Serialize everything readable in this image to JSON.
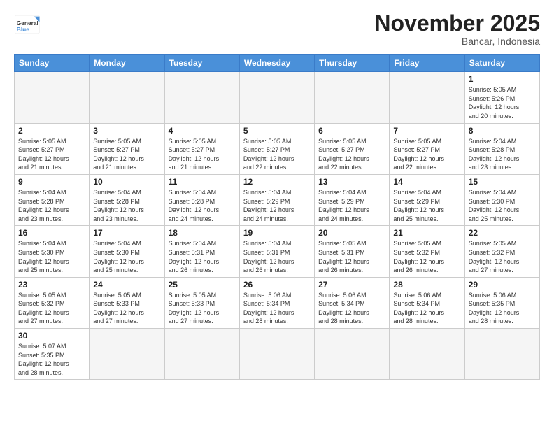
{
  "header": {
    "logo_general": "General",
    "logo_blue": "Blue",
    "month_title": "November 2025",
    "location": "Bancar, Indonesia"
  },
  "weekdays": [
    "Sunday",
    "Monday",
    "Tuesday",
    "Wednesday",
    "Thursday",
    "Friday",
    "Saturday"
  ],
  "weeks": [
    [
      {
        "day": "",
        "info": ""
      },
      {
        "day": "",
        "info": ""
      },
      {
        "day": "",
        "info": ""
      },
      {
        "day": "",
        "info": ""
      },
      {
        "day": "",
        "info": ""
      },
      {
        "day": "",
        "info": ""
      },
      {
        "day": "1",
        "info": "Sunrise: 5:05 AM\nSunset: 5:26 PM\nDaylight: 12 hours\nand 20 minutes."
      }
    ],
    [
      {
        "day": "2",
        "info": "Sunrise: 5:05 AM\nSunset: 5:27 PM\nDaylight: 12 hours\nand 21 minutes."
      },
      {
        "day": "3",
        "info": "Sunrise: 5:05 AM\nSunset: 5:27 PM\nDaylight: 12 hours\nand 21 minutes."
      },
      {
        "day": "4",
        "info": "Sunrise: 5:05 AM\nSunset: 5:27 PM\nDaylight: 12 hours\nand 21 minutes."
      },
      {
        "day": "5",
        "info": "Sunrise: 5:05 AM\nSunset: 5:27 PM\nDaylight: 12 hours\nand 22 minutes."
      },
      {
        "day": "6",
        "info": "Sunrise: 5:05 AM\nSunset: 5:27 PM\nDaylight: 12 hours\nand 22 minutes."
      },
      {
        "day": "7",
        "info": "Sunrise: 5:05 AM\nSunset: 5:27 PM\nDaylight: 12 hours\nand 22 minutes."
      },
      {
        "day": "8",
        "info": "Sunrise: 5:04 AM\nSunset: 5:28 PM\nDaylight: 12 hours\nand 23 minutes."
      }
    ],
    [
      {
        "day": "9",
        "info": "Sunrise: 5:04 AM\nSunset: 5:28 PM\nDaylight: 12 hours\nand 23 minutes."
      },
      {
        "day": "10",
        "info": "Sunrise: 5:04 AM\nSunset: 5:28 PM\nDaylight: 12 hours\nand 23 minutes."
      },
      {
        "day": "11",
        "info": "Sunrise: 5:04 AM\nSunset: 5:28 PM\nDaylight: 12 hours\nand 24 minutes."
      },
      {
        "day": "12",
        "info": "Sunrise: 5:04 AM\nSunset: 5:29 PM\nDaylight: 12 hours\nand 24 minutes."
      },
      {
        "day": "13",
        "info": "Sunrise: 5:04 AM\nSunset: 5:29 PM\nDaylight: 12 hours\nand 24 minutes."
      },
      {
        "day": "14",
        "info": "Sunrise: 5:04 AM\nSunset: 5:29 PM\nDaylight: 12 hours\nand 25 minutes."
      },
      {
        "day": "15",
        "info": "Sunrise: 5:04 AM\nSunset: 5:30 PM\nDaylight: 12 hours\nand 25 minutes."
      }
    ],
    [
      {
        "day": "16",
        "info": "Sunrise: 5:04 AM\nSunset: 5:30 PM\nDaylight: 12 hours\nand 25 minutes."
      },
      {
        "day": "17",
        "info": "Sunrise: 5:04 AM\nSunset: 5:30 PM\nDaylight: 12 hours\nand 25 minutes."
      },
      {
        "day": "18",
        "info": "Sunrise: 5:04 AM\nSunset: 5:31 PM\nDaylight: 12 hours\nand 26 minutes."
      },
      {
        "day": "19",
        "info": "Sunrise: 5:04 AM\nSunset: 5:31 PM\nDaylight: 12 hours\nand 26 minutes."
      },
      {
        "day": "20",
        "info": "Sunrise: 5:05 AM\nSunset: 5:31 PM\nDaylight: 12 hours\nand 26 minutes."
      },
      {
        "day": "21",
        "info": "Sunrise: 5:05 AM\nSunset: 5:32 PM\nDaylight: 12 hours\nand 26 minutes."
      },
      {
        "day": "22",
        "info": "Sunrise: 5:05 AM\nSunset: 5:32 PM\nDaylight: 12 hours\nand 27 minutes."
      }
    ],
    [
      {
        "day": "23",
        "info": "Sunrise: 5:05 AM\nSunset: 5:32 PM\nDaylight: 12 hours\nand 27 minutes."
      },
      {
        "day": "24",
        "info": "Sunrise: 5:05 AM\nSunset: 5:33 PM\nDaylight: 12 hours\nand 27 minutes."
      },
      {
        "day": "25",
        "info": "Sunrise: 5:05 AM\nSunset: 5:33 PM\nDaylight: 12 hours\nand 27 minutes."
      },
      {
        "day": "26",
        "info": "Sunrise: 5:06 AM\nSunset: 5:34 PM\nDaylight: 12 hours\nand 28 minutes."
      },
      {
        "day": "27",
        "info": "Sunrise: 5:06 AM\nSunset: 5:34 PM\nDaylight: 12 hours\nand 28 minutes."
      },
      {
        "day": "28",
        "info": "Sunrise: 5:06 AM\nSunset: 5:34 PM\nDaylight: 12 hours\nand 28 minutes."
      },
      {
        "day": "29",
        "info": "Sunrise: 5:06 AM\nSunset: 5:35 PM\nDaylight: 12 hours\nand 28 minutes."
      }
    ],
    [
      {
        "day": "30",
        "info": "Sunrise: 5:07 AM\nSunset: 5:35 PM\nDaylight: 12 hours\nand 28 minutes."
      },
      {
        "day": "",
        "info": ""
      },
      {
        "day": "",
        "info": ""
      },
      {
        "day": "",
        "info": ""
      },
      {
        "day": "",
        "info": ""
      },
      {
        "day": "",
        "info": ""
      },
      {
        "day": "",
        "info": ""
      }
    ]
  ]
}
